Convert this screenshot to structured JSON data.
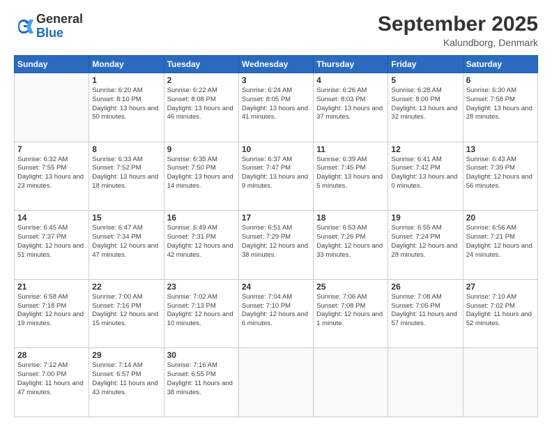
{
  "header": {
    "logo_general": "General",
    "logo_blue": "Blue",
    "month_title": "September 2025",
    "location": "Kalundborg, Denmark"
  },
  "weekdays": [
    "Sunday",
    "Monday",
    "Tuesday",
    "Wednesday",
    "Thursday",
    "Friday",
    "Saturday"
  ],
  "weeks": [
    [
      {
        "day": "",
        "sunrise": "",
        "sunset": "",
        "daylight": ""
      },
      {
        "day": "1",
        "sunrise": "Sunrise: 6:20 AM",
        "sunset": "Sunset: 8:10 PM",
        "daylight": "Daylight: 13 hours and 50 minutes."
      },
      {
        "day": "2",
        "sunrise": "Sunrise: 6:22 AM",
        "sunset": "Sunset: 8:08 PM",
        "daylight": "Daylight: 13 hours and 46 minutes."
      },
      {
        "day": "3",
        "sunrise": "Sunrise: 6:24 AM",
        "sunset": "Sunset: 8:05 PM",
        "daylight": "Daylight: 13 hours and 41 minutes."
      },
      {
        "day": "4",
        "sunrise": "Sunrise: 6:26 AM",
        "sunset": "Sunset: 8:03 PM",
        "daylight": "Daylight: 13 hours and 37 minutes."
      },
      {
        "day": "5",
        "sunrise": "Sunrise: 6:28 AM",
        "sunset": "Sunset: 8:00 PM",
        "daylight": "Daylight: 13 hours and 32 minutes."
      },
      {
        "day": "6",
        "sunrise": "Sunrise: 6:30 AM",
        "sunset": "Sunset: 7:58 PM",
        "daylight": "Daylight: 13 hours and 28 minutes."
      }
    ],
    [
      {
        "day": "7",
        "sunrise": "Sunrise: 6:32 AM",
        "sunset": "Sunset: 7:55 PM",
        "daylight": "Daylight: 13 hours and 23 minutes."
      },
      {
        "day": "8",
        "sunrise": "Sunrise: 6:33 AM",
        "sunset": "Sunset: 7:52 PM",
        "daylight": "Daylight: 13 hours and 18 minutes."
      },
      {
        "day": "9",
        "sunrise": "Sunrise: 6:35 AM",
        "sunset": "Sunset: 7:50 PM",
        "daylight": "Daylight: 13 hours and 14 minutes."
      },
      {
        "day": "10",
        "sunrise": "Sunrise: 6:37 AM",
        "sunset": "Sunset: 7:47 PM",
        "daylight": "Daylight: 13 hours and 9 minutes."
      },
      {
        "day": "11",
        "sunrise": "Sunrise: 6:39 AM",
        "sunset": "Sunset: 7:45 PM",
        "daylight": "Daylight: 13 hours and 5 minutes."
      },
      {
        "day": "12",
        "sunrise": "Sunrise: 6:41 AM",
        "sunset": "Sunset: 7:42 PM",
        "daylight": "Daylight: 13 hours and 0 minutes."
      },
      {
        "day": "13",
        "sunrise": "Sunrise: 6:43 AM",
        "sunset": "Sunset: 7:39 PM",
        "daylight": "Daylight: 12 hours and 56 minutes."
      }
    ],
    [
      {
        "day": "14",
        "sunrise": "Sunrise: 6:45 AM",
        "sunset": "Sunset: 7:37 PM",
        "daylight": "Daylight: 12 hours and 51 minutes."
      },
      {
        "day": "15",
        "sunrise": "Sunrise: 6:47 AM",
        "sunset": "Sunset: 7:34 PM",
        "daylight": "Daylight: 12 hours and 47 minutes."
      },
      {
        "day": "16",
        "sunrise": "Sunrise: 6:49 AM",
        "sunset": "Sunset: 7:31 PM",
        "daylight": "Daylight: 12 hours and 42 minutes."
      },
      {
        "day": "17",
        "sunrise": "Sunrise: 6:51 AM",
        "sunset": "Sunset: 7:29 PM",
        "daylight": "Daylight: 12 hours and 38 minutes."
      },
      {
        "day": "18",
        "sunrise": "Sunrise: 6:53 AM",
        "sunset": "Sunset: 7:26 PM",
        "daylight": "Daylight: 12 hours and 33 minutes."
      },
      {
        "day": "19",
        "sunrise": "Sunrise: 6:55 AM",
        "sunset": "Sunset: 7:24 PM",
        "daylight": "Daylight: 12 hours and 28 minutes."
      },
      {
        "day": "20",
        "sunrise": "Sunrise: 6:56 AM",
        "sunset": "Sunset: 7:21 PM",
        "daylight": "Daylight: 12 hours and 24 minutes."
      }
    ],
    [
      {
        "day": "21",
        "sunrise": "Sunrise: 6:58 AM",
        "sunset": "Sunset: 7:18 PM",
        "daylight": "Daylight: 12 hours and 19 minutes."
      },
      {
        "day": "22",
        "sunrise": "Sunrise: 7:00 AM",
        "sunset": "Sunset: 7:16 PM",
        "daylight": "Daylight: 12 hours and 15 minutes."
      },
      {
        "day": "23",
        "sunrise": "Sunrise: 7:02 AM",
        "sunset": "Sunset: 7:13 PM",
        "daylight": "Daylight: 12 hours and 10 minutes."
      },
      {
        "day": "24",
        "sunrise": "Sunrise: 7:04 AM",
        "sunset": "Sunset: 7:10 PM",
        "daylight": "Daylight: 12 hours and 6 minutes."
      },
      {
        "day": "25",
        "sunrise": "Sunrise: 7:06 AM",
        "sunset": "Sunset: 7:08 PM",
        "daylight": "Daylight: 12 hours and 1 minute."
      },
      {
        "day": "26",
        "sunrise": "Sunrise: 7:08 AM",
        "sunset": "Sunset: 7:05 PM",
        "daylight": "Daylight: 11 hours and 57 minutes."
      },
      {
        "day": "27",
        "sunrise": "Sunrise: 7:10 AM",
        "sunset": "Sunset: 7:02 PM",
        "daylight": "Daylight: 11 hours and 52 minutes."
      }
    ],
    [
      {
        "day": "28",
        "sunrise": "Sunrise: 7:12 AM",
        "sunset": "Sunset: 7:00 PM",
        "daylight": "Daylight: 11 hours and 47 minutes."
      },
      {
        "day": "29",
        "sunrise": "Sunrise: 7:14 AM",
        "sunset": "Sunset: 6:57 PM",
        "daylight": "Daylight: 11 hours and 43 minutes."
      },
      {
        "day": "30",
        "sunrise": "Sunrise: 7:16 AM",
        "sunset": "Sunset: 6:55 PM",
        "daylight": "Daylight: 11 hours and 38 minutes."
      },
      {
        "day": "",
        "sunrise": "",
        "sunset": "",
        "daylight": ""
      },
      {
        "day": "",
        "sunrise": "",
        "sunset": "",
        "daylight": ""
      },
      {
        "day": "",
        "sunrise": "",
        "sunset": "",
        "daylight": ""
      },
      {
        "day": "",
        "sunrise": "",
        "sunset": "",
        "daylight": ""
      }
    ]
  ]
}
